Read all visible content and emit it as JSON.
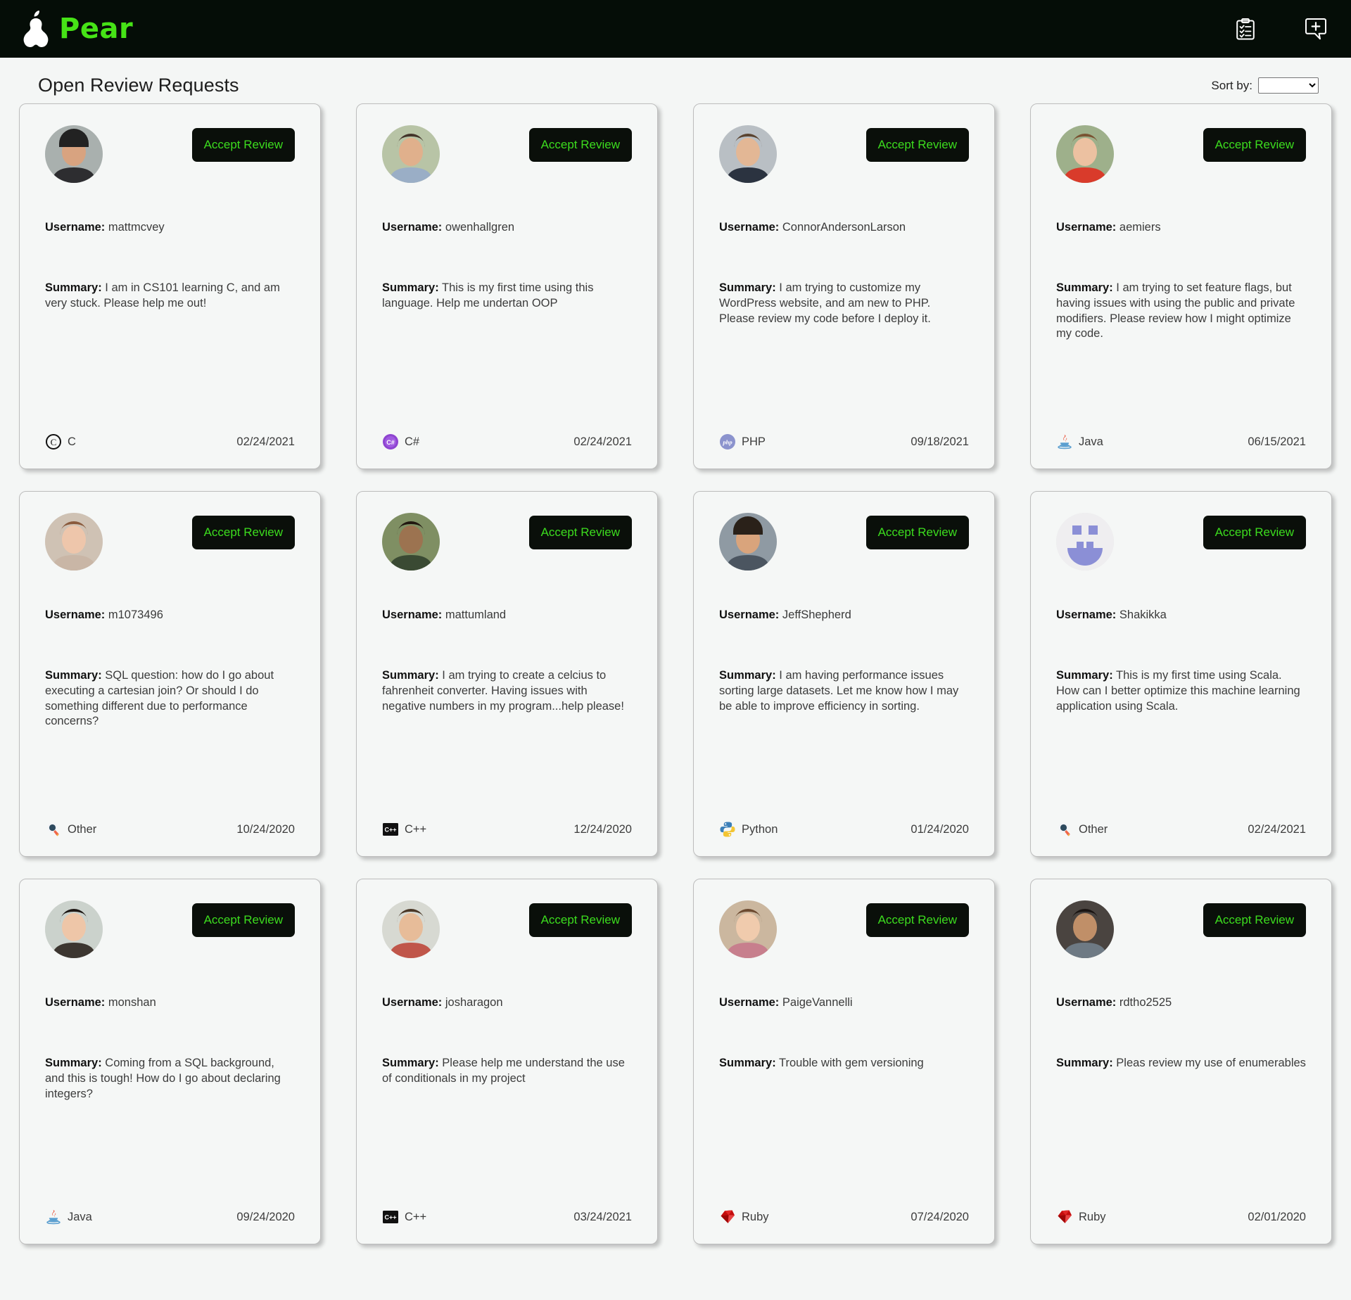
{
  "header": {
    "brand_name": "Pear",
    "logo_icon": "pear-logo-icon",
    "actions": [
      {
        "icon": "clipboard-checklist-icon",
        "name": "my-reviews-button"
      },
      {
        "icon": "add-comment-bubble-icon",
        "name": "new-request-button"
      }
    ]
  },
  "page": {
    "title": "Open Review Requests",
    "sort_label": "Sort by:",
    "sort_value": "",
    "sort_options": [
      ""
    ]
  },
  "accept_label": "Accept Review",
  "labels": {
    "username": "Username:",
    "summary": "Summary:"
  },
  "colors": {
    "brand_green": "#46e316",
    "button_green": "#3cdd1e",
    "button_bg": "#0a0f0a",
    "topbar_bg": "#050d07",
    "page_bg": "#f4f6f5",
    "card_bg": "#f5f7f6"
  },
  "cards": [
    {
      "username": "mattmcvey",
      "summary": "I am in CS101 learning C, and am very stuck. Please help me out!",
      "language": "C",
      "language_icon": "c-language-icon",
      "date": "02/24/2021",
      "avatar": "photo-man-cap"
    },
    {
      "username": "owenhallgren",
      "summary": "This is my first time using this language. Help me undertan OOP",
      "language": "C#",
      "language_icon": "csharp-language-icon",
      "date": "02/24/2021",
      "avatar": "photo-man-plaid"
    },
    {
      "username": "ConnorAndersonLarson",
      "summary": "I am trying to customize my WordPress website, and am new to PHP. Please review my code before I deploy it.",
      "language": "PHP",
      "language_icon": "php-language-icon",
      "date": "09/18/2021",
      "avatar": "photo-man-suit"
    },
    {
      "username": "aemiers",
      "summary": "I am trying to set feature flags, but having issues with using the public and private modifiers. Please review how I might optimize my code.",
      "language": "Java",
      "language_icon": "java-language-icon",
      "date": "06/15/2021",
      "avatar": "photo-woman-red"
    },
    {
      "username": "m1073496",
      "summary": "SQL question: how do I go about executing a cartesian join? Or should I do something different due to performance concerns?",
      "language": "Other",
      "language_icon": "other-language-icon",
      "date": "10/24/2020",
      "avatar": "photo-woman-curly"
    },
    {
      "username": "mattumland",
      "summary": "I am trying to create a celcius to fahrenheit converter. Having issues with negative numbers in my program...help please!",
      "language": "C++",
      "language_icon": "cpp-language-icon",
      "date": "12/24/2020",
      "avatar": "photo-man-outdoors"
    },
    {
      "username": "JeffShepherd",
      "summary": "I am having performance issues sorting large datasets. Let me know how I may be able to improve efficiency in sorting.",
      "language": "Python",
      "language_icon": "python-language-icon",
      "date": "01/24/2020",
      "avatar": "photo-man-dog"
    },
    {
      "username": "Shakikka",
      "summary": "This is my first time using Scala. How can I better optimize this machine learning application using Scala.",
      "language": "Other",
      "language_icon": "other-language-icon",
      "date": "02/24/2021",
      "avatar": "placeholder-avatar"
    },
    {
      "username": "monshan",
      "summary": "Coming from a SQL background, and this is tough! How do I go about declaring integers?",
      "language": "Java",
      "language_icon": "java-language-icon",
      "date": "09/24/2020",
      "avatar": "photo-woman-dark-hair"
    },
    {
      "username": "josharagon",
      "summary": "Please help me understand the use of conditionals in my project",
      "language": "C++",
      "language_icon": "cpp-language-icon",
      "date": "03/24/2021",
      "avatar": "photo-man-plaid-shirt"
    },
    {
      "username": "PaigeVannelli",
      "summary": "Trouble with gem versioning",
      "language": "Ruby",
      "language_icon": "ruby-language-icon",
      "date": "07/24/2020",
      "avatar": "photo-woman-pink"
    },
    {
      "username": "rdtho2525",
      "summary": "Pleas review my use of enumerables",
      "language": "Ruby",
      "language_icon": "ruby-language-icon",
      "date": "02/01/2020",
      "avatar": "photo-person-indoor"
    }
  ]
}
